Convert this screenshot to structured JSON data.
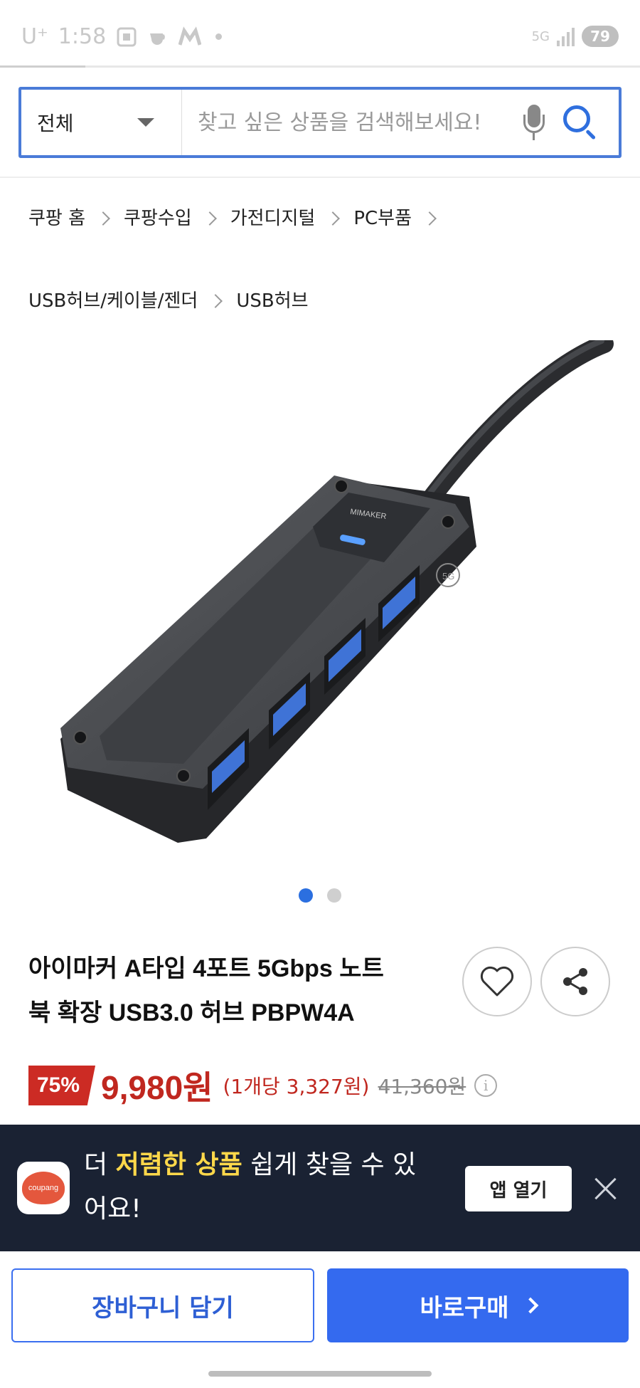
{
  "status_bar": {
    "carrier": "U⁺",
    "time": "1:58",
    "network": "5G",
    "battery": "79"
  },
  "search": {
    "category": "전체",
    "placeholder": "찾고 싶은 상품을 검색해보세요!"
  },
  "breadcrumb": {
    "items": [
      "쿠팡 홈",
      "쿠팡수입",
      "가전디지털",
      "PC부품",
      "USB허브/케이블/젠더",
      "USB허브"
    ]
  },
  "product_image": {
    "brand_mark": "MIMAKER",
    "badge": "5G",
    "page_index": 1,
    "page_count": 2
  },
  "product": {
    "title_line1": "아이마커 A타입 4포트 5Gbps 노트",
    "title_line2": "북 확장 USB3.0 허브 PBPW4A"
  },
  "price": {
    "discount": "75%",
    "sale": "9,980원",
    "unit": "(1개당 3,327원)",
    "original": "41,360원",
    "info_glyph": "i"
  },
  "app_banner": {
    "logo_text": "coupang",
    "msg_pre": "더 ",
    "msg_highlight": "저렴한 상품",
    "msg_post": " 쉽게 찾을 수 있어요!",
    "open_label": "앱 열기"
  },
  "actions": {
    "cart_label": "장바구니 담기",
    "buy_label": "바로구매"
  },
  "colors": {
    "accent": "#346aef",
    "sale_red": "#c0271f",
    "banner_bg": "#1a2233",
    "highlight": "#ffd84a"
  }
}
